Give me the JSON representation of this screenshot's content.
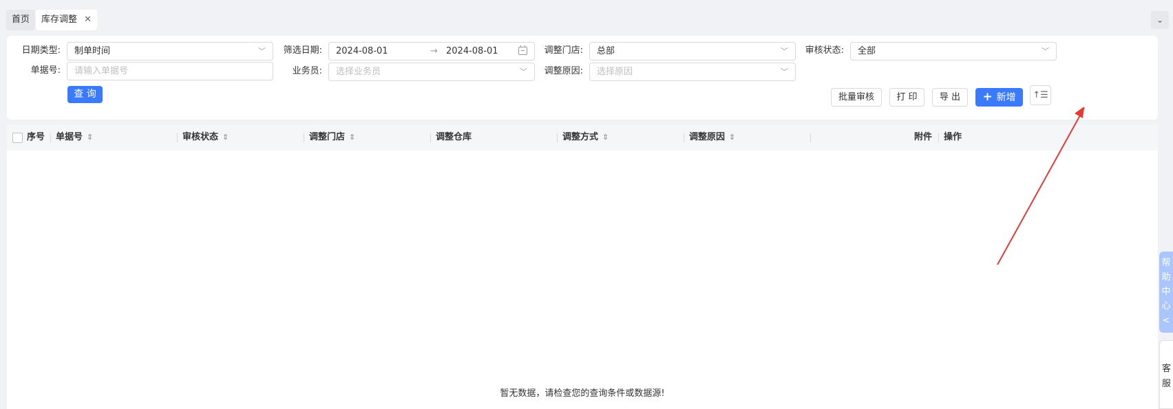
{
  "tabs": {
    "home": "首页",
    "current": "库存调整",
    "close": "✕",
    "collapse": "⌄"
  },
  "filters": {
    "date_type_label": "日期类型:",
    "date_type_value": "制单时间",
    "filter_date_label": "筛选日期:",
    "date_start": "2024-08-01",
    "date_sep": "→",
    "date_end": "2024-08-01",
    "store_label": "调整门店:",
    "store_value": "总部",
    "audit_label": "审核状态:",
    "audit_value": "全部",
    "doc_no_label": "单据号:",
    "doc_no_placeholder": "请输入单据号",
    "salesman_label": "业务员:",
    "salesman_placeholder": "选择业务员",
    "reason_label": "调整原因:",
    "reason_placeholder": "选择原因",
    "query_button": "查 询"
  },
  "toolbar": {
    "batch_audit": "批量审核",
    "print": "打 印",
    "export": "导 出",
    "add_plus": "+",
    "add": "新增",
    "sort_icon": "↑☰"
  },
  "table": {
    "columns": {
      "seq": "序号",
      "doc_no": "单据号",
      "audit_status": "审核状态",
      "store": "调整门店",
      "warehouse": "调整仓库",
      "method": "调整方式",
      "reason": "调整原因",
      "attachment": "附件",
      "operation": "操作"
    },
    "sort_glyph": "⇕",
    "empty_text": "暂无数据，请检查您的查询条件或数据源!"
  },
  "side": {
    "help": [
      "帮",
      "助",
      "中",
      "心",
      "<"
    ],
    "cs": [
      "客",
      "服"
    ]
  },
  "colors": {
    "primary": "#3a7afe",
    "annotation_arrow": "#e53935"
  }
}
